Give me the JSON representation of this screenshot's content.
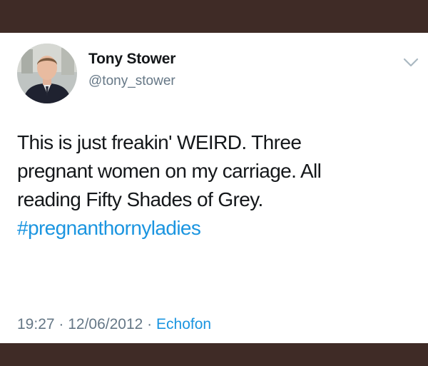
{
  "tweet": {
    "display_name": "Tony Stower",
    "handle": "@tony_stower",
    "text_line_1": "This is just freakin' WEIRD. Three",
    "text_line_2": "pregnant women on my carriage. All",
    "text_line_3": "reading Fifty Shades of Grey.",
    "hashtag": "#pregnanthornyladies",
    "time": "19:27",
    "separator": " · ",
    "date": "12/06/2012",
    "source": "Echofon"
  },
  "icons": {
    "menu": "chevron-down-icon"
  },
  "colors": {
    "frame": "#3f2b26",
    "text": "#14171a",
    "muted": "#657786",
    "link": "#1b95e0"
  }
}
